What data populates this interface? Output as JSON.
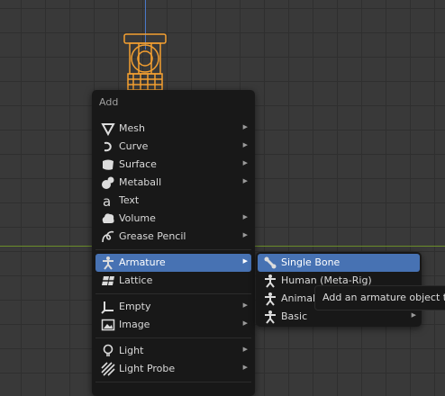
{
  "add_menu": {
    "title": "Add",
    "items": [
      {
        "label": "Mesh",
        "icon": "mesh-icon",
        "submenu": true
      },
      {
        "label": "Curve",
        "icon": "curve-icon",
        "submenu": true
      },
      {
        "label": "Surface",
        "icon": "surface-icon",
        "submenu": true
      },
      {
        "label": "Metaball",
        "icon": "metaball-icon",
        "submenu": true
      },
      {
        "label": "Text",
        "icon": "text-icon",
        "submenu": false
      },
      {
        "label": "Volume",
        "icon": "volume-icon",
        "submenu": true
      },
      {
        "label": "Grease Pencil",
        "icon": "grease-pencil-icon",
        "submenu": true
      },
      {
        "label": "Armature",
        "icon": "armature-icon",
        "submenu": true,
        "active": true
      },
      {
        "label": "Lattice",
        "icon": "lattice-icon",
        "submenu": false
      },
      {
        "label": "Empty",
        "icon": "empty-icon",
        "submenu": true
      },
      {
        "label": "Image",
        "icon": "image-icon",
        "submenu": true
      },
      {
        "label": "Light",
        "icon": "light-icon",
        "submenu": true
      },
      {
        "label": "Light Probe",
        "icon": "light-probe-icon",
        "submenu": true
      }
    ]
  },
  "armature_submenu": {
    "items": [
      {
        "label": "Single Bone",
        "icon": "bone-icon",
        "active": true
      },
      {
        "label": "Human (Meta-Rig)",
        "icon": "armature-icon"
      },
      {
        "label": "Animal",
        "icon": "armature-icon"
      },
      {
        "label": "Basic",
        "icon": "armature-icon",
        "submenu": true
      }
    ]
  },
  "tooltip": {
    "text": "Add an armature object to the scene"
  },
  "colors": {
    "accent": "#4772b3",
    "object_outline": "#f5a030",
    "grid": "#393939"
  }
}
